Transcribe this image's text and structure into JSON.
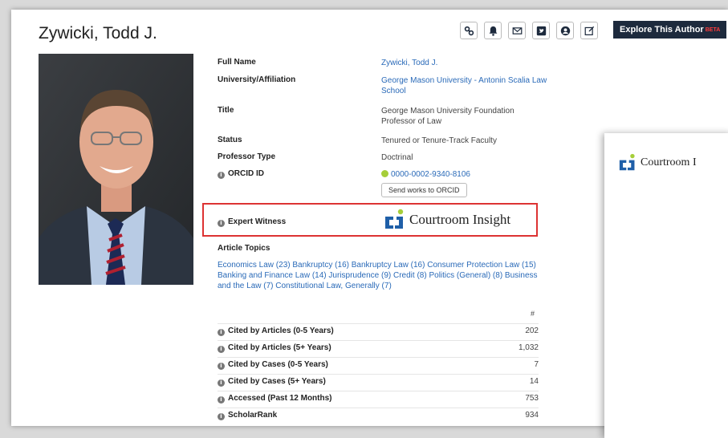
{
  "author": {
    "name": "Zywicki, Todd J."
  },
  "toolbar": {
    "explore_label": "Explore This Author",
    "explore_badge": "BETA"
  },
  "colors": {
    "accent_link": "#2a6ab8",
    "explore_bg": "#1d2a3d",
    "highlight_border": "#dd3333",
    "orcid_green": "#a6ce39"
  },
  "details": {
    "full_name_label": "Full Name",
    "full_name": "Zywicki, Todd J.",
    "affiliation_label": "University/Affiliation",
    "affiliation": "George Mason University - Antonin Scalia Law School",
    "title_label": "Title",
    "title": "George Mason University Foundation Professor of Law",
    "status_label": "Status",
    "status": "Tenured or Tenure-Track Faculty",
    "professor_type_label": "Professor Type",
    "professor_type": "Doctrinal",
    "orcid_label": "ORCID ID",
    "orcid": "0000-0002-9340-8106",
    "send_orcid_label": "Send works to ORCID",
    "expert_witness_label": "Expert Witness",
    "courtroom_insight": "Courtroom Insight"
  },
  "topics": {
    "label": "Article Topics",
    "text": "Economics Law (23) Bankruptcy (16) Bankruptcy Law (16) Consumer Protection Law (15) Banking and Finance Law (14) Jurisprudence (9) Credit (8) Politics (General) (8) Business and the Law (7) Constitutional Law, Generally (7)"
  },
  "stats": {
    "header": "#",
    "rows": [
      {
        "label": "Cited by Articles (0-5 Years)",
        "value": "202"
      },
      {
        "label": "Cited by Articles (5+ Years)",
        "value": "1,032"
      },
      {
        "label": "Cited by Cases (0-5 Years)",
        "value": "7"
      },
      {
        "label": "Cited by Cases (5+ Years)",
        "value": "14"
      },
      {
        "label": "Accessed (Past 12 Months)",
        "value": "753"
      },
      {
        "label": "ScholarRank",
        "value": "934"
      }
    ]
  },
  "panel": {
    "logo_text": "Courtroom I"
  }
}
